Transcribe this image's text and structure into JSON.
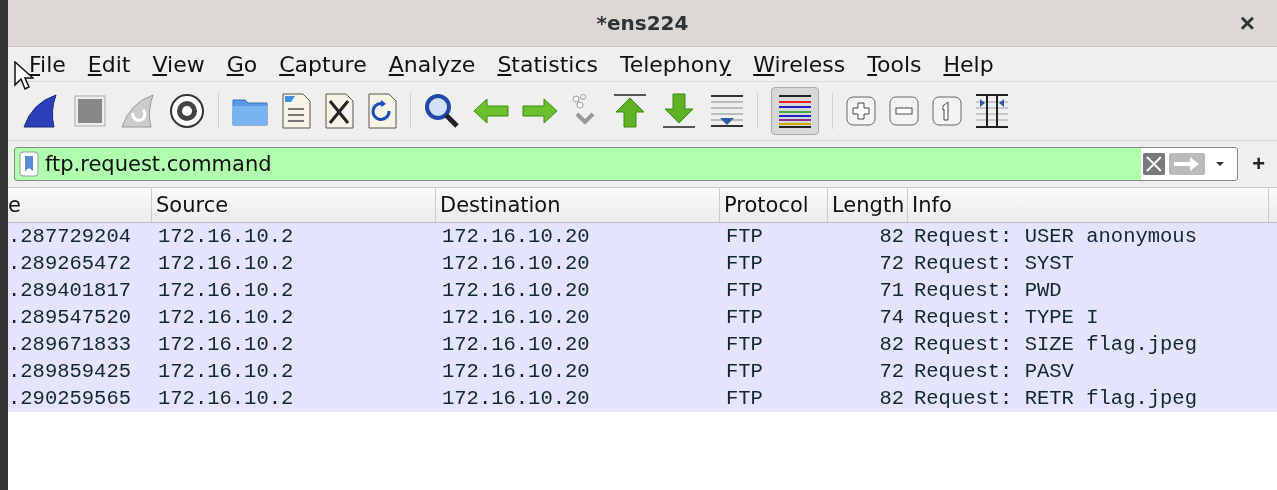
{
  "window": {
    "title": "*ens224",
    "close": "×"
  },
  "menu": [
    {
      "label": "File",
      "underline_last": false
    },
    {
      "label": "Edit",
      "underline_last": false
    },
    {
      "label": "View",
      "underline_last": false
    },
    {
      "label": "Go",
      "underline_last": false
    },
    {
      "label": "Capture",
      "underline_last": false
    },
    {
      "label": "Analyze",
      "underline_last": false
    },
    {
      "label": "Statistics",
      "underline_last": false
    },
    {
      "label": "Telephony",
      "underline_last": true
    },
    {
      "label": "Wireless",
      "underline_last": false
    },
    {
      "label": "Tools",
      "underline_last": false
    },
    {
      "label": "Help",
      "underline_last": false
    }
  ],
  "toolbar": {
    "colorize_on": true
  },
  "filter": {
    "value": "ftp.request.command",
    "valid": true,
    "add": "+"
  },
  "table": {
    "columns": [
      "e",
      "Source",
      "Destination",
      "Protocol",
      "Length",
      "Info"
    ],
    "rows": [
      {
        "cells": [
          ".287729204",
          "172.16.10.2",
          "172.16.10.20",
          "FTP",
          "82",
          "Request: USER anonymous"
        ],
        "color": "#e4e4fc"
      },
      {
        "cells": [
          ".289265472",
          "172.16.10.2",
          "172.16.10.20",
          "FTP",
          "72",
          "Request: SYST"
        ],
        "color": "#e4e4fc"
      },
      {
        "cells": [
          ".289401817",
          "172.16.10.2",
          "172.16.10.20",
          "FTP",
          "71",
          "Request: PWD"
        ],
        "color": "#e4e4fc"
      },
      {
        "cells": [
          ".289547520",
          "172.16.10.2",
          "172.16.10.20",
          "FTP",
          "74",
          "Request: TYPE I"
        ],
        "color": "#e4e4fc"
      },
      {
        "cells": [
          ".289671833",
          "172.16.10.2",
          "172.16.10.20",
          "FTP",
          "82",
          "Request: SIZE flag.jpeg"
        ],
        "color": "#e4e4fc"
      },
      {
        "cells": [
          ".289859425",
          "172.16.10.2",
          "172.16.10.20",
          "FTP",
          "72",
          "Request: PASV"
        ],
        "color": "#e4e4fc"
      },
      {
        "cells": [
          ".290259565",
          "172.16.10.2",
          "172.16.10.20",
          "FTP",
          "82",
          "Request: RETR flag.jpeg"
        ],
        "color": "#e4e4fc"
      }
    ]
  }
}
